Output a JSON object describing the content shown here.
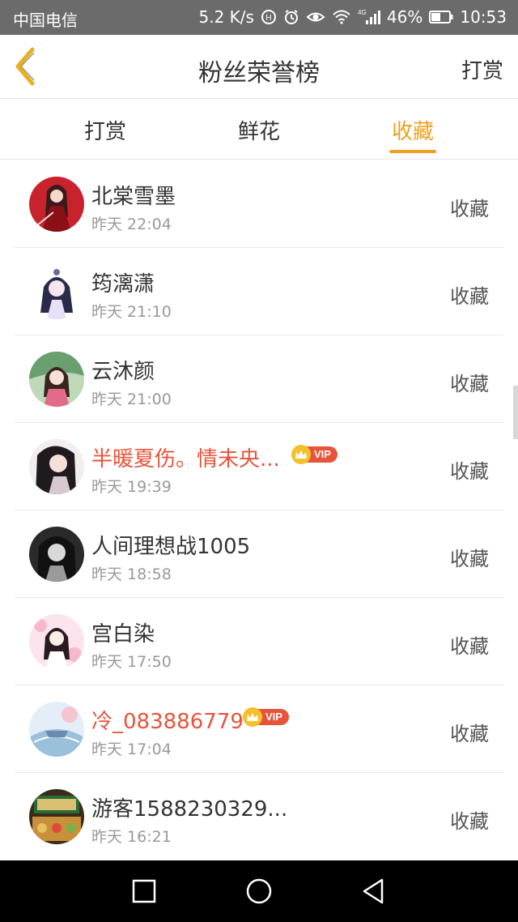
{
  "statusbar": {
    "carrier": "中国电信",
    "speed": "5.2 K/s",
    "signal_label": "4G",
    "battery": "46%",
    "time": "10:53"
  },
  "navbar": {
    "title": "粉丝荣誉榜",
    "action": "打赏"
  },
  "tabs": [
    {
      "label": "打赏",
      "active": false
    },
    {
      "label": "鲜花",
      "active": false
    },
    {
      "label": "收藏",
      "active": true
    }
  ],
  "colors": {
    "accent": "#f0a020",
    "vip_name": "#e8543a"
  },
  "vip_badge_text": "VIP",
  "rows": [
    {
      "name": "北棠雪墨",
      "time": "昨天 22:04",
      "action": "收藏",
      "vip": false
    },
    {
      "name": "筠漓潇",
      "time": "昨天 21:10",
      "action": "收藏",
      "vip": false
    },
    {
      "name": "云沐颜",
      "time": "昨天 21:00",
      "action": "收藏",
      "vip": false
    },
    {
      "name": "半暖夏伤。情未央...",
      "time": "昨天 19:39",
      "action": "收藏",
      "vip": true
    },
    {
      "name": "人间理想战1005",
      "time": "昨天 18:58",
      "action": "收藏",
      "vip": false
    },
    {
      "name": "宫白染",
      "time": "昨天 17:50",
      "action": "收藏",
      "vip": false
    },
    {
      "name": "冷_083886779",
      "time": "昨天 17:04",
      "action": "收藏",
      "vip": true
    },
    {
      "name": "游客1588230329...",
      "time": "昨天 16:21",
      "action": "收藏",
      "vip": false
    }
  ]
}
